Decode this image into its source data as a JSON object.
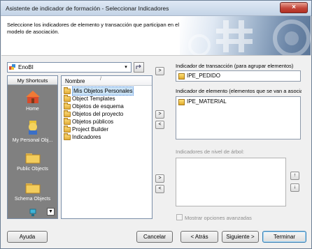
{
  "window": {
    "title": "Asistente de indicador de formación - Seleccionar Indicadores",
    "close_icon": "×"
  },
  "header": {
    "description": "Seleccione los indicadores de elemento y transacción que participan en el modelo de asociación."
  },
  "project_combo": {
    "value": "EnoBI",
    "arrow": "▾"
  },
  "shortcuts": {
    "title": "My Shortcuts",
    "items": [
      {
        "label": "Home",
        "icon": "home-icon"
      },
      {
        "label": "My Personal Obj...",
        "icon": "personal-objects-icon"
      },
      {
        "label": "Public Objects",
        "icon": "folder-icon"
      },
      {
        "label": "Schema Objects",
        "icon": "folder-icon"
      }
    ],
    "scroll_glyph": "▼"
  },
  "file_list": {
    "header": "Nombre",
    "sort_glyph": "/",
    "rows": [
      {
        "label": "Mis Objetos Personales",
        "selected": true
      },
      {
        "label": "Object Templates"
      },
      {
        "label": "Objetos de esquema"
      },
      {
        "label": "Objetos del proyecto"
      },
      {
        "label": "Objetos públicos"
      },
      {
        "label": "Project Builder"
      },
      {
        "label": "Indicadores"
      }
    ]
  },
  "transaction": {
    "label": "Indicador de transacción (para agrupar elementos)",
    "value": "IPE_PEDIDO"
  },
  "element": {
    "label": "Indicador de elemento (elementos que se van a asociar)",
    "items": [
      "IPE_MATERIAL"
    ]
  },
  "tree_level": {
    "label": "Indicadores de nivel de árbol:",
    "up_glyph": "↑",
    "down_glyph": "↓"
  },
  "move_buttons": {
    "add": ">",
    "remove": "<"
  },
  "advanced_option": {
    "label": "Mostrar opciones avanzadas",
    "checked": false
  },
  "footer": {
    "help": "Ayuda",
    "cancel": "Cancelar",
    "back": "< Atrás",
    "next": "Siguiente >",
    "finish": "Terminar"
  }
}
